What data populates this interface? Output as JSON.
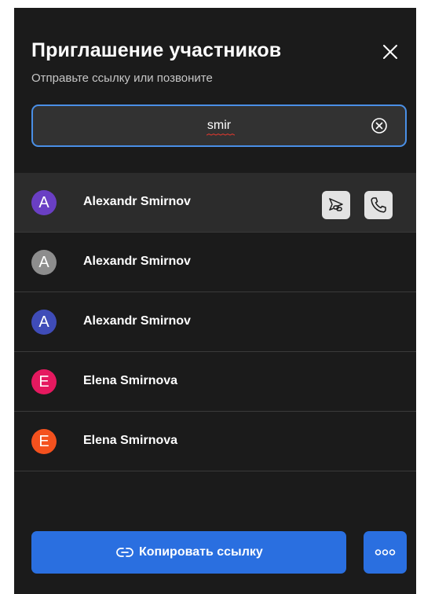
{
  "dialog": {
    "title": "Приглашение участников",
    "subtitle": "Отправьте ссылку или позвоните"
  },
  "search": {
    "value": "smir",
    "accent_color": "#4a8fe6"
  },
  "results": [
    {
      "initial": "A",
      "name": "Alexandr Smirnov",
      "avatar_color": "#6a3fc4",
      "highlighted": true
    },
    {
      "initial": "A",
      "name": "Alexandr Smirnov",
      "avatar_color": "#8d8d8d",
      "highlighted": false
    },
    {
      "initial": "A",
      "name": "Alexandr Smirnov",
      "avatar_color": "#3f4cb8",
      "highlighted": false
    },
    {
      "initial": "E",
      "name": "Elena Smirnova",
      "avatar_color": "#e5195f",
      "highlighted": false
    },
    {
      "initial": "E",
      "name": "Elena Smirnova",
      "avatar_color": "#f4511e",
      "highlighted": false
    }
  ],
  "row_actions": {
    "icons": [
      "send-link-icon",
      "phone-icon"
    ]
  },
  "footer": {
    "copy_label": "Копировать ссылку",
    "button_color": "#2a6fe0",
    "icons": [
      "link-icon",
      "more-icon"
    ]
  }
}
